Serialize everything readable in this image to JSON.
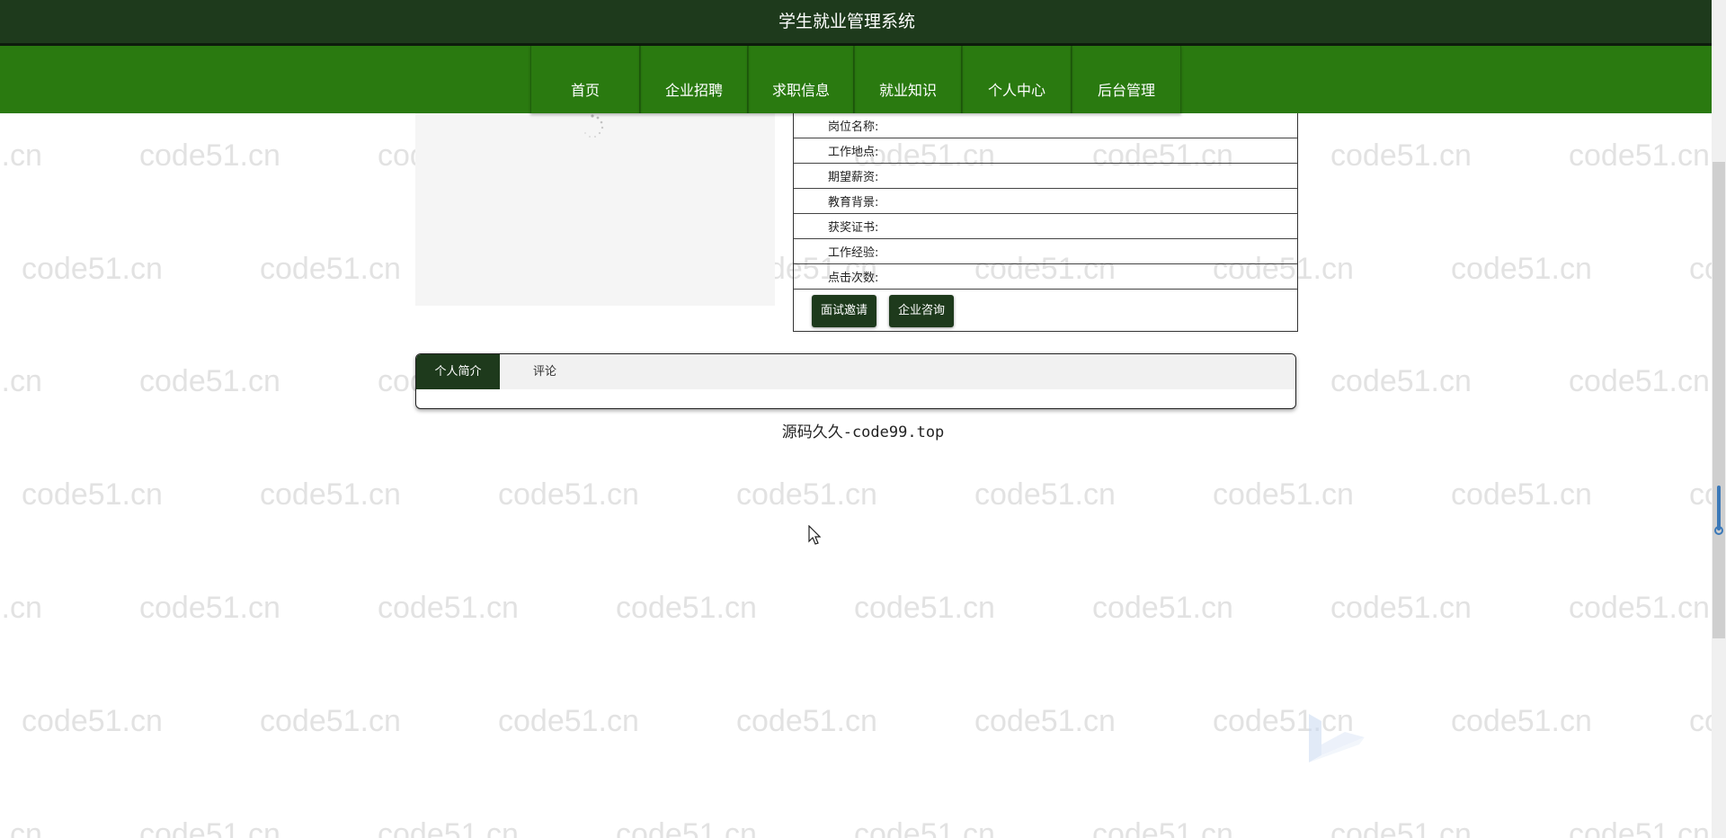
{
  "header": {
    "title": "学生就业管理系统"
  },
  "nav": {
    "items": [
      {
        "label": "首页"
      },
      {
        "label": "企业招聘"
      },
      {
        "label": "求职信息"
      },
      {
        "label": "就业知识"
      },
      {
        "label": "个人中心"
      },
      {
        "label": "后台管理"
      }
    ]
  },
  "detail": {
    "fields": [
      {
        "label": "岗位名称:"
      },
      {
        "label": "工作地点:"
      },
      {
        "label": "期望薪资:"
      },
      {
        "label": "教育背景:"
      },
      {
        "label": "获奖证书:"
      },
      {
        "label": "工作经验:"
      },
      {
        "label": "点击次数:"
      }
    ],
    "buttons": {
      "interview": "面试邀请",
      "consult": "企业咨询"
    }
  },
  "tabs": [
    {
      "label": "个人简介",
      "active": true
    },
    {
      "label": "评论",
      "active": false
    }
  ],
  "footer": {
    "text": "源码久久-code99.top"
  },
  "watermark": {
    "text": "code51.cn"
  },
  "colors": {
    "header_bg": "#1e3a1c",
    "nav_bg": "#2a7a10",
    "button_bg": "#1e3a1c",
    "scroll_accent": "#3a78b8"
  }
}
